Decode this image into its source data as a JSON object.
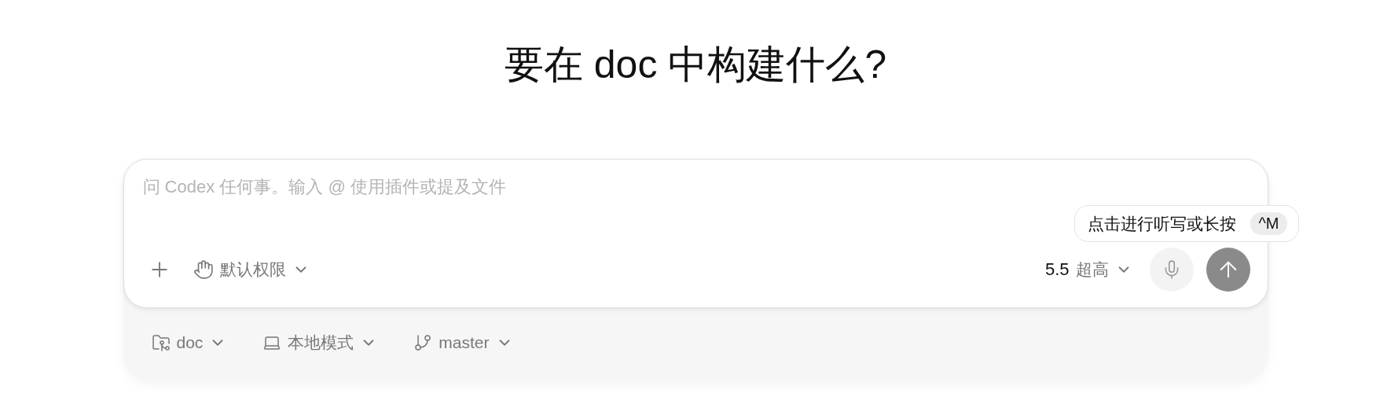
{
  "heading": "要在 doc 中构建什么?",
  "composer": {
    "placeholder": "问 Codex 任何事。输入 @ 使用插件或提及文件",
    "permission": "默认权限",
    "model": "5.5",
    "effort": "超高"
  },
  "tooltip": {
    "text": "点击进行听写或长按",
    "shortcut": "^M"
  },
  "context": [
    {
      "kind": "folder",
      "label": "doc"
    },
    {
      "kind": "laptop",
      "label": "本地模式"
    },
    {
      "kind": "branch",
      "label": "master"
    }
  ]
}
